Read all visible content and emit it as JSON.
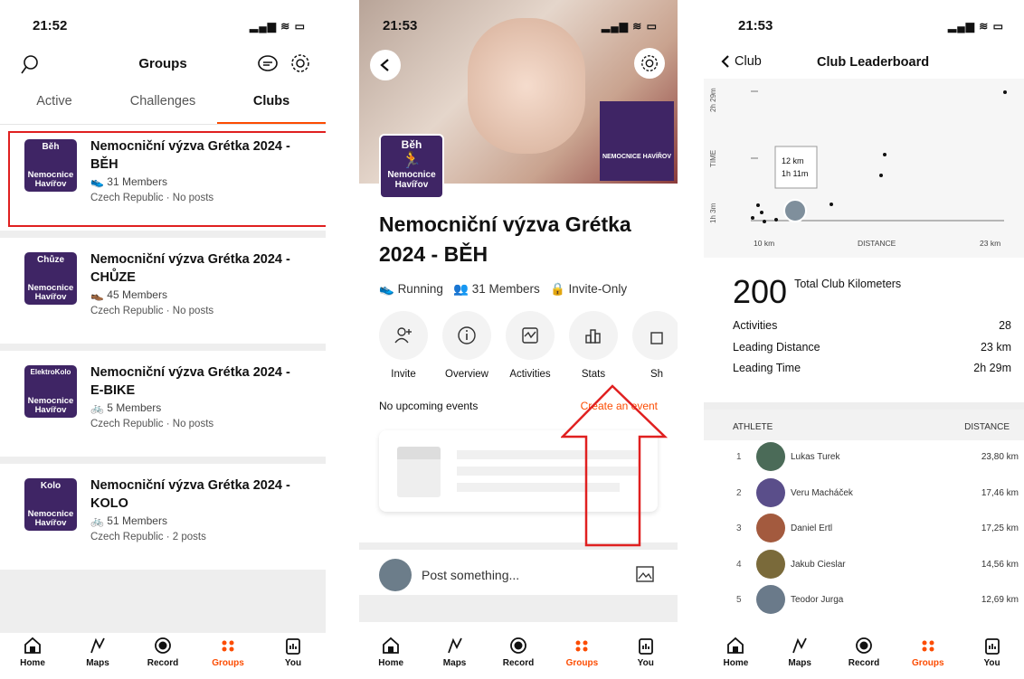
{
  "p1": {
    "time": "21:52",
    "title": "Groups",
    "tabs": [
      "Active",
      "Challenges",
      "Clubs"
    ],
    "clubs": [
      {
        "logo_top": "Běh",
        "logo_bottom": "Nemocnice Havířov",
        "name": "Nemocniční výzva Grétka 2024 - BĚH",
        "members": "31 Members",
        "sub": "Czech Republic · No posts"
      },
      {
        "logo_top": "Chůze",
        "logo_bottom": "Nemocnice Havířov",
        "name": "Nemocniční výzva Grétka 2024 - CHŮZE",
        "members": "45 Members",
        "sub": "Czech Republic · No posts"
      },
      {
        "logo_top": "ElektroKolo",
        "logo_bottom": "Nemocnice Havířov",
        "name": "Nemocniční výzva Grétka 2024 - E-BIKE",
        "members": "5 Members",
        "sub": "Czech Republic · No posts"
      },
      {
        "logo_top": "Kolo",
        "logo_bottom": "Nemocnice Havířov",
        "name": "Nemocniční výzva Grétka 2024 - KOLO",
        "members": "51 Members",
        "sub": "Czech Republic · 2 posts"
      }
    ]
  },
  "p2": {
    "time": "21:53",
    "cover_logo": "NEMOCNICE HAVÍŘOV",
    "logo_top": "Běh",
    "logo_bottom": "Nemocnice Havířov",
    "title": "Nemocniční výzva Grétka 2024 - BĚH",
    "sport": "Running",
    "members": "31 Members",
    "privacy": "Invite-Only",
    "actions": [
      "Invite",
      "Overview",
      "Activities",
      "Stats",
      "Sh"
    ],
    "no_events": "No upcoming events",
    "create_event": "Create an event",
    "post_placeholder": "Post something..."
  },
  "p3": {
    "time": "21:53",
    "back": "Club",
    "title": "Club Leaderboard",
    "chart": {
      "y_top": "2h 29m",
      "y_mid": "TIME",
      "y_bot": "1h 3m",
      "x_left": "10 km",
      "x_mid": "DISTANCE",
      "x_right": "23 km",
      "tooltip_dist": "12 km",
      "tooltip_time": "1h 11m"
    },
    "total": "200",
    "total_label": "Total Club Kilometers",
    "stats": [
      {
        "label": "Activities",
        "value": "28"
      },
      {
        "label": "Leading Distance",
        "value": "23 km"
      },
      {
        "label": "Leading Time",
        "value": "2h 29m"
      }
    ],
    "col_athlete": "ATHLETE",
    "col_distance": "DISTANCE",
    "rows": [
      {
        "rank": "1",
        "name": "Lukas Turek",
        "dist": "23,80 km"
      },
      {
        "rank": "2",
        "name": "Veru Macháček",
        "dist": "17,46 km"
      },
      {
        "rank": "3",
        "name": "Daniel Ertl",
        "dist": "17,25 km"
      },
      {
        "rank": "4",
        "name": "Jakub Cieslar",
        "dist": "14,56 km"
      },
      {
        "rank": "5",
        "name": "Teodor Jurga",
        "dist": "12,69 km"
      }
    ]
  },
  "nav": [
    "Home",
    "Maps",
    "Record",
    "Groups",
    "You"
  ],
  "colors": {
    "accent": "#fc4c02",
    "club": "#3f2565",
    "highlight": "#e02020"
  }
}
